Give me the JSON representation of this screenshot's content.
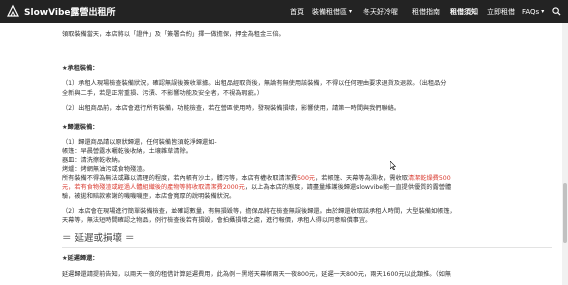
{
  "header": {
    "brand": "SlowVibe露營出租所",
    "nav": [
      {
        "label": "首頁",
        "active": false
      },
      {
        "label": "裝備租借區",
        "active": false,
        "dropdown": true
      },
      {
        "label": "冬天好冷喔",
        "active": false
      },
      {
        "label": "租借指南",
        "active": false
      },
      {
        "label": "租借須知",
        "active": true
      },
      {
        "label": "立即租借",
        "active": false
      },
      {
        "label": "FAQs",
        "active": false,
        "dropdown": true
      }
    ],
    "dropdown_glyph": "▾",
    "search_icon": "search-icon"
  },
  "content": {
    "intro": "領取裝備當天，本店將以「證件」及「簽署合約」擇一做擔保，押金為租金三倍。",
    "section_pickup": {
      "title": "★承租裝備：",
      "p1a": "（1）承租人現場檢查裝備狀況，確認無誤後簽收單據。出租品經取貨後，無論有無使用該裝備，不得以任何理由要求退貨及退款。（出租品分",
      "p1b": "全新與二手，若是正常重損、污漬、不影響功能及安全者，不視為瑕疵。）",
      "p2": "（2）出租商品前，本店會進行所有裝備，功能檢查，若在營區使用時，發現裝備損壞，影響使用，請第一時間與我們聯絡。"
    },
    "section_return": {
      "title": "★歸還裝備：",
      "p1": "（1）歸還商品請以原狀歸還，任何裝備皆須乾淨歸還如-",
      "list": [
        "帳篷：早晨營露水曬乾後收納，土壤雜草清除。",
        "器皿：清洗擦乾收納。",
        "烤爐：烤網無油污或食物殘渣。"
      ],
      "warn1_pre": "所有裝備不得為無法或難以清理的程度，若內帳有沙土，髒污等，本店有權收取清潔費",
      "warn1_red1": "500元",
      "warn1_mid": "，若帳篷、天幕等為濕收，需收取",
      "warn1_red2": "清潔乾燥費500",
      "warn2_red": "元，若有食物殘渣或經過人體組織後的產物等將收取清潔費2000元",
      "warn2_post": "，以上為本店的態度，請盡量維護後歸還slowvibe能一直提供優質的露營體",
      "warn3": "驗，被拋和賠款索謝的嘰嘰嘰歪，本店會寬厚的說明裝備狀況。",
      "p2a": "（2）本店會在現場進行簡單裝備檢查，並確認數量，有無損毀等，擔保品將在檢查無誤後歸還。由於歸還收取該承租人時間，大型裝備如帳篷，",
      "p2b": "天幕等，無法短時間確認之物品，例行檢查後若有損毀，會拍攝損壞之處，進行報價，承租人得以同意賠償事宜。"
    },
    "heading_delay": "＝ 延遲或損壞 ＝",
    "section_delay": {
      "title": "★延遲歸還：",
      "p1": "延遲歸還請提前告知，以兩天一夜的租借計算延遲費用，此為例－黑塔天幕帳兩天一夜800元，延遲一天800元，兩天1600元以此類推。（如無"
    }
  }
}
